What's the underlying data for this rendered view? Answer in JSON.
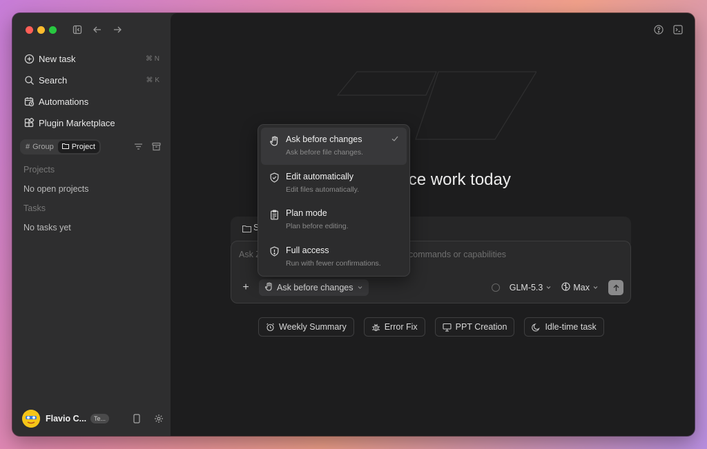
{
  "sidebar": {
    "nav": [
      {
        "label": "New task",
        "shortcut": "⌘ N",
        "icon": "plus-circle-icon"
      },
      {
        "label": "Search",
        "shortcut": "⌘ K",
        "icon": "search-icon"
      },
      {
        "label": "Automations",
        "shortcut": "",
        "icon": "calendar-clock-icon"
      },
      {
        "label": "Plugin Marketplace",
        "shortcut": "",
        "icon": "plugin-icon"
      }
    ],
    "segment": {
      "group": "Group",
      "project": "Project",
      "active": "project"
    },
    "projects_title": "Projects",
    "projects_empty": "No open projects",
    "tasks_title": "Tasks",
    "tasks_empty": "No tasks yet",
    "user": {
      "name": "Flavio C...",
      "badge": "Te..."
    }
  },
  "main": {
    "greeting": "nice work today",
    "folder_label": "S",
    "placeholder_left": "Ask Z",
    "placeholder_right": "commands or capabilities",
    "mode_label": "Ask before changes",
    "model": "GLM-5.3",
    "effort": "Max",
    "chips": [
      {
        "label": "Weekly Summary",
        "icon": "alarm-clock-icon"
      },
      {
        "label": "Error Fix",
        "icon": "bug-icon"
      },
      {
        "label": "PPT Creation",
        "icon": "presentation-icon"
      },
      {
        "label": "Idle-time task",
        "icon": "moon-icon"
      }
    ]
  },
  "menu": {
    "items": [
      {
        "title": "Ask before changes",
        "desc": "Ask before file changes.",
        "icon": "hand-icon",
        "selected": true
      },
      {
        "title": "Edit automatically",
        "desc": "Edit files automatically.",
        "icon": "shield-check-icon",
        "selected": false
      },
      {
        "title": "Plan mode",
        "desc": "Plan before editing.",
        "icon": "clipboard-icon",
        "selected": false
      },
      {
        "title": "Full access",
        "desc": "Run with fewer confirmations.",
        "icon": "shield-alert-icon",
        "selected": false
      }
    ]
  },
  "colors": {
    "accent_red": "#ff5f57",
    "accent_yellow": "#febc2e",
    "accent_green": "#28c840",
    "avatar": "#f5c518"
  }
}
